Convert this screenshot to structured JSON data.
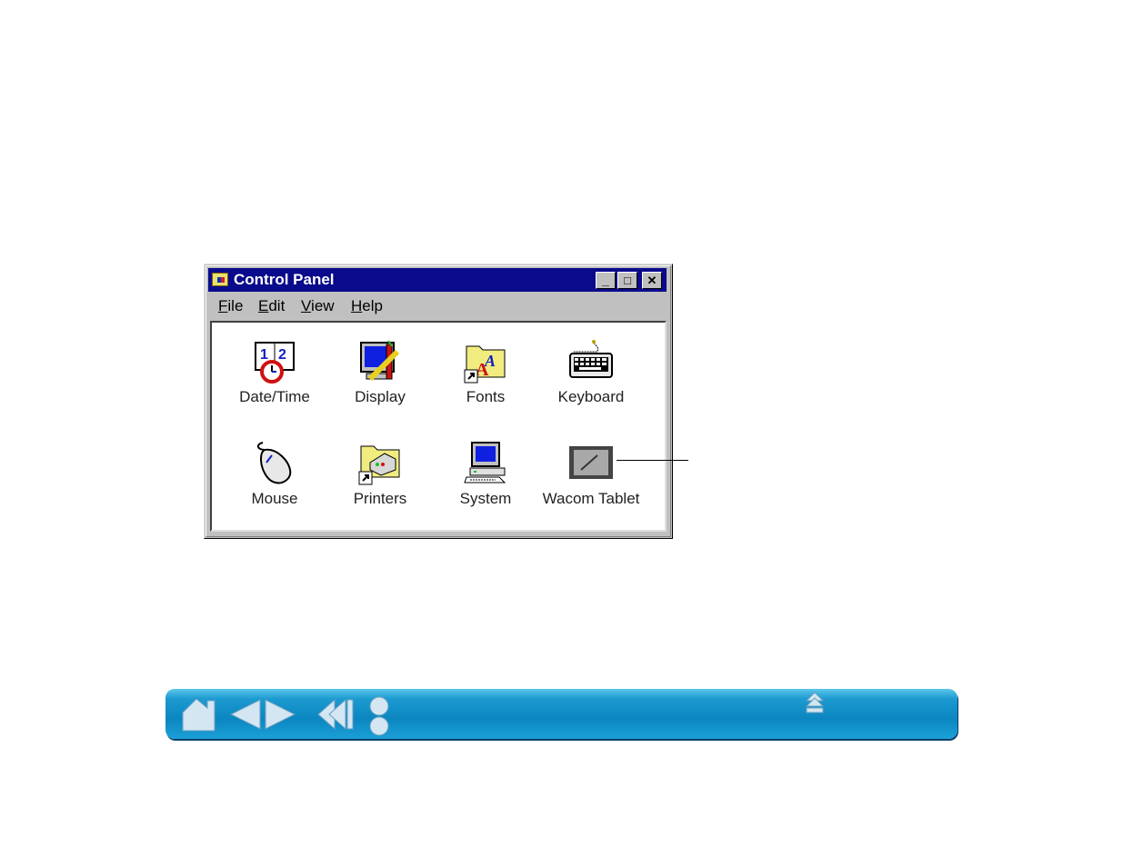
{
  "window": {
    "title": "Control Panel",
    "controls": {
      "minimize": "_",
      "maximize": "□",
      "close": "✕"
    },
    "menu": [
      {
        "label": "File",
        "accel": "F",
        "rest": "ile"
      },
      {
        "label": "Edit",
        "accel": "E",
        "rest": "dit"
      },
      {
        "label": "View",
        "accel": "V",
        "rest": "iew"
      },
      {
        "label": "Help",
        "accel": "H",
        "rest": "elp"
      }
    ],
    "items": [
      {
        "label": "Date/Time",
        "icon": "calendar-clock-icon"
      },
      {
        "label": "Display",
        "icon": "display-icon"
      },
      {
        "label": "Fonts",
        "icon": "fonts-folder-icon"
      },
      {
        "label": "Keyboard",
        "icon": "keyboard-icon"
      },
      {
        "label": "Mouse",
        "icon": "mouse-icon"
      },
      {
        "label": "Printers",
        "icon": "printers-folder-icon"
      },
      {
        "label": "System",
        "icon": "computer-icon"
      },
      {
        "label": "Wacom Tablet",
        "icon": "tablet-icon"
      }
    ]
  },
  "navbar": {
    "buttons": [
      "home",
      "previous-page",
      "next-page",
      "back",
      "index-toc"
    ],
    "top_button": "go-to-top",
    "colors": {
      "base": "#0c86c0",
      "highlight": "#5cc6ea"
    }
  }
}
